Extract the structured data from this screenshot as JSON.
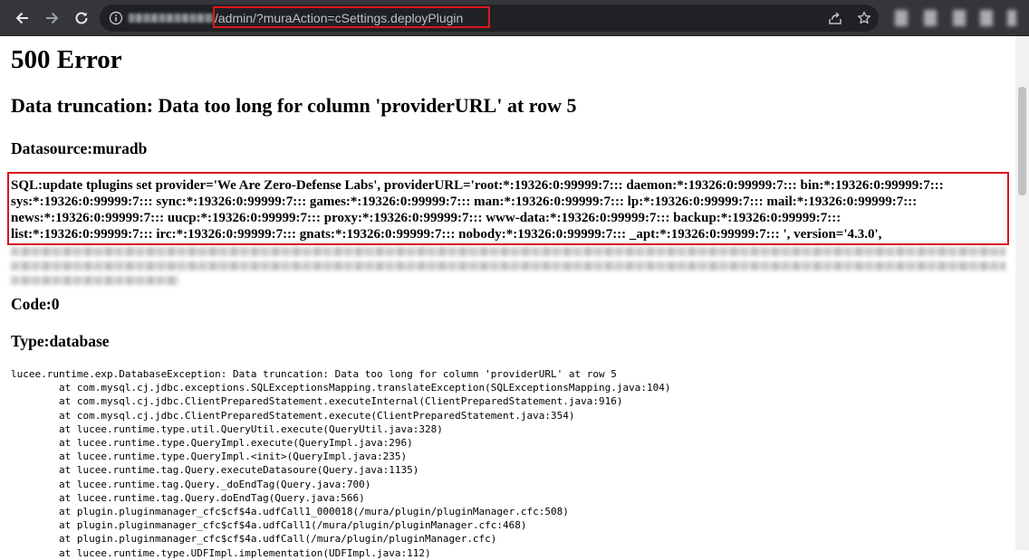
{
  "browser": {
    "url_path": "/admin/?muraAction=cSettings.deployPlugin",
    "icons": [
      "back-arrow-icon",
      "forward-arrow-icon",
      "reload-icon",
      "info-icon",
      "share-icon",
      "star-icon"
    ]
  },
  "page": {
    "title": "500 Error",
    "message": "Data truncation: Data too long for column 'providerURL' at row 5",
    "datasource": "Datasource:muradb",
    "sql_lines": [
      "SQL:update tplugins set provider='We Are Zero-Defense Labs', providerURL='root:*:19326:0:99999:7::: daemon:*:19326:0:99999:7::: bin:*:19326:0:99999:7:::",
      "sys:*:19326:0:99999:7::: sync:*:19326:0:99999:7::: games:*:19326:0:99999:7::: man:*:19326:0:99999:7::: lp:*:19326:0:99999:7::: mail:*:19326:0:99999:7:::",
      "news:*:19326:0:99999:7::: uucp:*:19326:0:99999:7::: proxy:*:19326:0:99999:7::: www-data:*:19326:0:99999:7::: backup:*:19326:0:99999:7:::",
      "list:*:19326:0:99999:7::: irc:*:19326:0:99999:7::: gnats:*:19326:0:99999:7::: nobody:*:19326:0:99999:7::: _apt:*:19326:0:99999:7::: ', version='4.3.0',"
    ],
    "code": "Code:0",
    "type": "Type:database",
    "stack_trace": [
      "lucee.runtime.exp.DatabaseException: Data truncation: Data too long for column 'providerURL' at row 5",
      "        at com.mysql.cj.jdbc.exceptions.SQLExceptionsMapping.translateException(SQLExceptionsMapping.java:104)",
      "        at com.mysql.cj.jdbc.ClientPreparedStatement.executeInternal(ClientPreparedStatement.java:916)",
      "        at com.mysql.cj.jdbc.ClientPreparedStatement.execute(ClientPreparedStatement.java:354)",
      "        at lucee.runtime.type.util.QueryUtil.execute(QueryUtil.java:328)",
      "        at lucee.runtime.type.QueryImpl.execute(QueryImpl.java:296)",
      "        at lucee.runtime.type.QueryImpl.<init>(QueryImpl.java:235)",
      "        at lucee.runtime.tag.Query.executeDatasoure(Query.java:1135)",
      "        at lucee.runtime.tag.Query._doEndTag(Query.java:700)",
      "        at lucee.runtime.tag.Query.doEndTag(Query.java:566)",
      "        at plugin.pluginmanager_cfc$cf$4a.udfCall1_000018(/mura/plugin/pluginManager.cfc:508)",
      "        at plugin.pluginmanager_cfc$cf$4a.udfCall1(/mura/plugin/pluginManager.cfc:468)",
      "        at plugin.pluginmanager_cfc$cf$4a.udfCall(/mura/plugin/pluginManager.cfc)",
      "        at lucee.runtime.type.UDFImpl.implementation(UDFImpl.java:112)"
    ]
  },
  "colors": {
    "toolbar": "#35363a",
    "omnibox": "#202124",
    "highlight_box": "#e0151b"
  }
}
